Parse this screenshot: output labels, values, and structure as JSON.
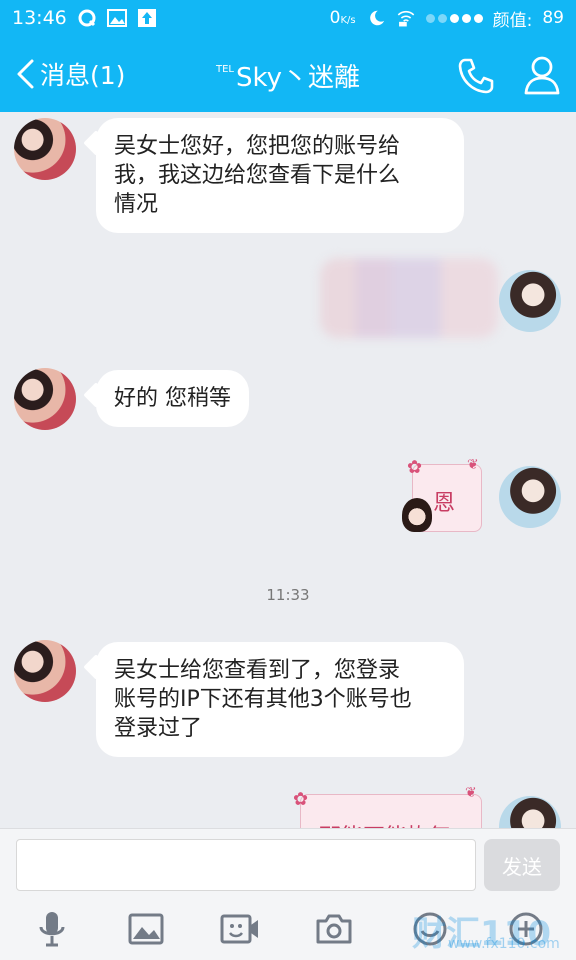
{
  "status_bar": {
    "time": "13:46",
    "speed": "0",
    "speed_unit": "K/s",
    "battery_label": "颜值:",
    "battery_value": "89"
  },
  "header": {
    "back_label": "消息(1)",
    "title_prefix": "TEL",
    "title": "Sky丶迷離"
  },
  "messages": [
    {
      "side": "them",
      "text_lines": [
        "吴女士您好，您把您的账号给",
        "我，我这边给您查看下是什么",
        "情况"
      ]
    },
    {
      "side": "me",
      "type": "blurred"
    },
    {
      "side": "them",
      "text": "好的 您稍等"
    },
    {
      "side": "me",
      "type": "sticker",
      "text": "恩"
    },
    {
      "side": "them",
      "text_lines": [
        "吴女士给您查看到了，您登录",
        "账号的IP下还有其他3个账号也",
        "登录过了"
      ]
    },
    {
      "side": "me",
      "type": "sticker",
      "text": "那能不能恢复"
    }
  ],
  "timestamp": "11:33",
  "input": {
    "placeholder": "",
    "send_label": "发送"
  },
  "toolbar": {
    "items": [
      "mic-icon",
      "image-icon",
      "video-icon",
      "camera-icon",
      "emoji-icon",
      "plus-icon"
    ]
  },
  "watermark": {
    "text": "财汇110网",
    "url": "www.fx110.com"
  },
  "colors": {
    "accent": "#12b7f5",
    "background": "#ebedf1"
  }
}
